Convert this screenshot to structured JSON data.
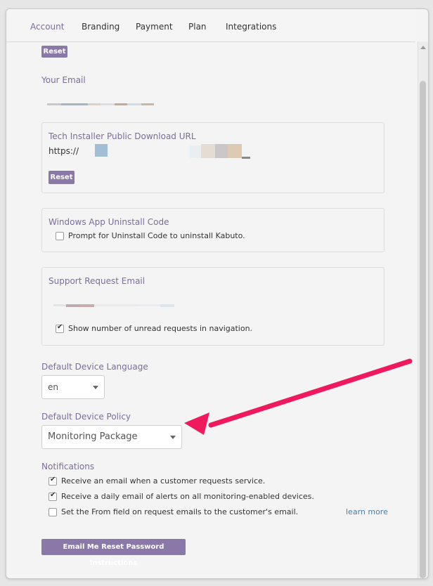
{
  "tabs": [
    "Account",
    "Branding",
    "Payment",
    "Plan",
    "Integrations"
  ],
  "top_reset_label": "Reset",
  "your_email_label": "Your Email",
  "tech_installer": {
    "title": "Tech Installer Public Download URL",
    "url_prefix": "https://",
    "reset_label": "Reset"
  },
  "windows_app": {
    "title": "Windows App Uninstall Code",
    "checkbox_label": "Prompt for Uninstall Code to uninstall Kabuto.",
    "checked": false
  },
  "support_request": {
    "title": "Support Request Email",
    "checkbox_label": "Show number of unread requests in navigation.",
    "checked": true
  },
  "default_language": {
    "label": "Default Device Language",
    "value": "en"
  },
  "default_policy": {
    "label": "Default Device Policy",
    "value": "Monitoring Package"
  },
  "notifications": {
    "label": "Notifications",
    "items": [
      {
        "text": "Receive an email when a customer requests service.",
        "checked": true
      },
      {
        "text": "Receive a daily email of alerts on all monitoring-enabled devices.",
        "checked": true
      },
      {
        "text": "Set the From field on request emails to the customer's email.",
        "checked": false
      }
    ],
    "learn_more": "learn more"
  },
  "reset_password_label": "Email Me Reset Password Instructions",
  "colors": {
    "accent": "#8a79a8",
    "label": "#7c6b9c",
    "arrow": "#f0195e"
  }
}
